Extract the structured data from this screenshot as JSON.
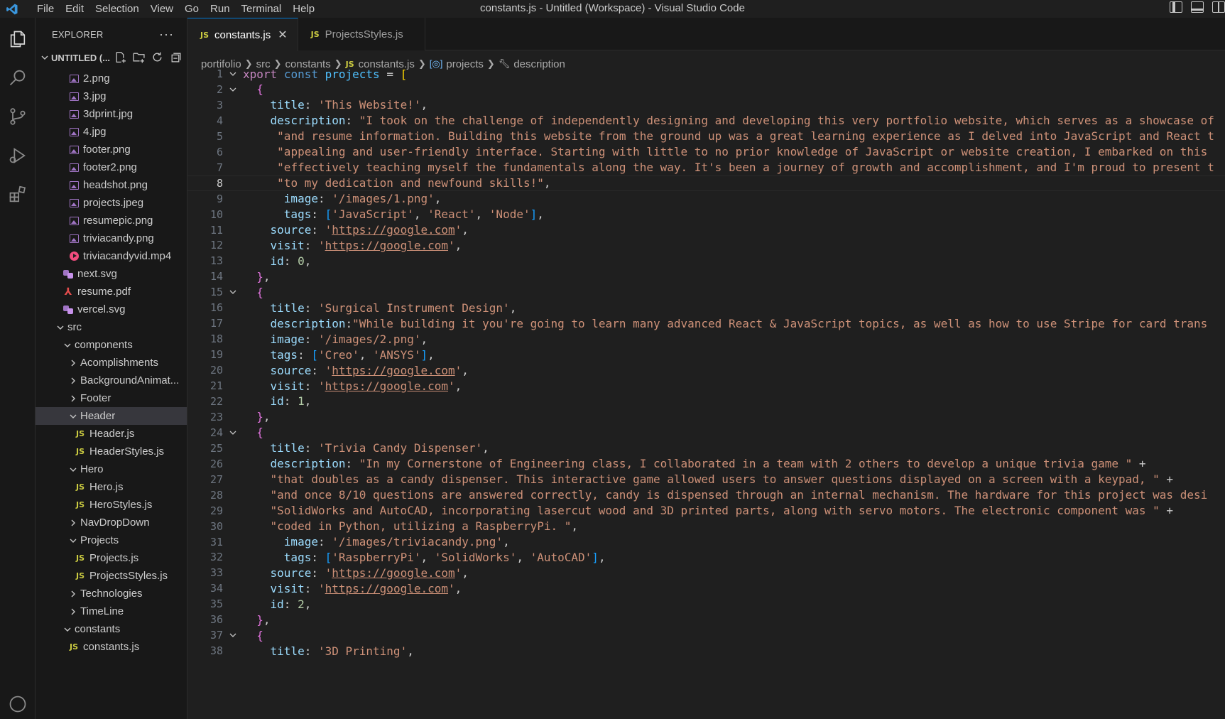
{
  "window": {
    "title": "constants.js - Untitled (Workspace) - Visual Studio Code",
    "menu": [
      "File",
      "Edit",
      "Selection",
      "View",
      "Go",
      "Run",
      "Terminal",
      "Help"
    ]
  },
  "sidebar": {
    "title": "EXPLORER",
    "workspace": "UNTITLED (...",
    "tree": [
      {
        "label": "2.png",
        "icon": "image-icon",
        "depth": 3
      },
      {
        "label": "3.jpg",
        "icon": "image-icon",
        "depth": 3
      },
      {
        "label": "3dprint.jpg",
        "icon": "image-icon",
        "depth": 3
      },
      {
        "label": "4.jpg",
        "icon": "image-icon",
        "depth": 3
      },
      {
        "label": "footer.png",
        "icon": "image-icon",
        "depth": 3
      },
      {
        "label": "footer2.png",
        "icon": "image-icon",
        "depth": 3
      },
      {
        "label": "headshot.png",
        "icon": "image-icon",
        "depth": 3
      },
      {
        "label": "projects.jpeg",
        "icon": "image-icon",
        "depth": 3
      },
      {
        "label": "resumepic.png",
        "icon": "image-icon",
        "depth": 3
      },
      {
        "label": "triviacandy.png",
        "icon": "image-icon",
        "depth": 3
      },
      {
        "label": "triviacandyvid.mp4",
        "icon": "video-icon",
        "depth": 3
      },
      {
        "label": "next.svg",
        "icon": "svg-file-icon",
        "depth": 2
      },
      {
        "label": "resume.pdf",
        "icon": "pdf-icon",
        "depth": 2
      },
      {
        "label": "vercel.svg",
        "icon": "svg-file-icon",
        "depth": 2
      },
      {
        "label": "src",
        "icon": "chevron-down-icon",
        "depth": 1
      },
      {
        "label": "components",
        "icon": "chevron-down-icon",
        "depth": 2
      },
      {
        "label": "Acomplishments",
        "icon": "chevron-right-icon",
        "depth": 3
      },
      {
        "label": "BackgroundAnimat...",
        "icon": "chevron-right-icon",
        "depth": 3
      },
      {
        "label": "Footer",
        "icon": "chevron-right-icon",
        "depth": 3
      },
      {
        "label": "Header",
        "icon": "chevron-down-icon",
        "depth": 3,
        "selected": true
      },
      {
        "label": "Header.js",
        "icon": "js-file-icon",
        "depth": 4
      },
      {
        "label": "HeaderStyles.js",
        "icon": "js-file-icon",
        "depth": 4
      },
      {
        "label": "Hero",
        "icon": "chevron-down-icon",
        "depth": 3
      },
      {
        "label": "Hero.js",
        "icon": "js-file-icon",
        "depth": 4
      },
      {
        "label": "HeroStyles.js",
        "icon": "js-file-icon",
        "depth": 4
      },
      {
        "label": "NavDropDown",
        "icon": "chevron-right-icon",
        "depth": 3
      },
      {
        "label": "Projects",
        "icon": "chevron-down-icon",
        "depth": 3
      },
      {
        "label": "Projects.js",
        "icon": "js-file-icon",
        "depth": 4
      },
      {
        "label": "ProjectsStyles.js",
        "icon": "js-file-icon",
        "depth": 4
      },
      {
        "label": "Technologies",
        "icon": "chevron-right-icon",
        "depth": 3
      },
      {
        "label": "TimeLine",
        "icon": "chevron-right-icon",
        "depth": 3
      },
      {
        "label": "constants",
        "icon": "chevron-down-icon",
        "depth": 2
      },
      {
        "label": "constants.js",
        "icon": "js-file-icon",
        "depth": 3
      }
    ]
  },
  "tabs": [
    {
      "label": "constants.js",
      "active": true,
      "close": "✕"
    },
    {
      "label": "ProjectsStyles.js",
      "active": false
    }
  ],
  "breadcrumb": [
    "portifolio",
    "src",
    "constants",
    "constants.js",
    "projects",
    "description"
  ],
  "editor": {
    "current_line": 8,
    "lines": [
      {
        "n": "1",
        "fold": "v",
        "code": "xport const projects = ["
      },
      {
        "n": "2",
        "fold": "v",
        "code": "  {"
      },
      {
        "n": "3",
        "code": "    title: 'This Website!',"
      },
      {
        "n": "4",
        "code": "    description: \"I took on the challenge of independently designing and developing this very portfolio website, which serves as a showcase of"
      },
      {
        "n": "5",
        "code": "     \"and resume information. Building this website from the ground up was a great learning experience as I delved into JavaScript and React t"
      },
      {
        "n": "6",
        "code": "     \"appealing and user-friendly interface. Starting with little to no prior knowledge of JavaScript or website creation, I embarked on this"
      },
      {
        "n": "7",
        "code": "     \"effectively teaching myself the fundamentals along the way. It's been a journey of growth and accomplishment, and I'm proud to present t"
      },
      {
        "n": "8",
        "code": "     \"to my dedication and newfound skills!\","
      },
      {
        "n": "9",
        "code": "      image: '/images/1.png',"
      },
      {
        "n": "10",
        "code": "      tags: ['JavaScript', 'React', 'Node'],"
      },
      {
        "n": "11",
        "code": "    source: 'https://google.com',"
      },
      {
        "n": "12",
        "code": "    visit: 'https://google.com',"
      },
      {
        "n": "13",
        "code": "    id: 0,"
      },
      {
        "n": "14",
        "code": "  },"
      },
      {
        "n": "15",
        "fold": "v",
        "code": "  {"
      },
      {
        "n": "16",
        "code": "    title: 'Surgical Instrument Design',"
      },
      {
        "n": "17",
        "code": "    description:\"While building it you're going to learn many advanced React & JavaScript topics, as well as how to use Stripe for card trans"
      },
      {
        "n": "18",
        "code": "    image: '/images/2.png',"
      },
      {
        "n": "19",
        "code": "    tags: ['Creo', 'ANSYS'],"
      },
      {
        "n": "20",
        "code": "    source: 'https://google.com',"
      },
      {
        "n": "21",
        "code": "    visit: 'https://google.com',"
      },
      {
        "n": "22",
        "code": "    id: 1,"
      },
      {
        "n": "23",
        "code": "  },"
      },
      {
        "n": "24",
        "fold": "v",
        "code": "  {"
      },
      {
        "n": "25",
        "code": "    title: 'Trivia Candy Dispenser',"
      },
      {
        "n": "26",
        "code": "    description: \"In my Cornerstone of Engineering class, I collaborated in a team with 2 others to develop a unique trivia game \" +"
      },
      {
        "n": "27",
        "code": "    \"that doubles as a candy dispenser. This interactive game allowed users to answer questions displayed on a screen with a keypad, \" +"
      },
      {
        "n": "28",
        "code": "    \"and once 8/10 questions are answered correctly, candy is dispensed through an internal mechanism. The hardware for this project was desi"
      },
      {
        "n": "29",
        "code": "    \"SolidWorks and AutoCAD, incorporating lasercut wood and 3D printed parts, along with servo motors. The electronic component was \" +"
      },
      {
        "n": "30",
        "code": "    \"coded in Python, utilizing a RaspberryPi. \","
      },
      {
        "n": "31",
        "code": "      image: '/images/triviacandy.png',"
      },
      {
        "n": "32",
        "code": "      tags: ['RaspberryPi', 'SolidWorks', 'AutoCAD'],"
      },
      {
        "n": "33",
        "code": "    source: 'https://google.com',"
      },
      {
        "n": "34",
        "code": "    visit: 'https://google.com',"
      },
      {
        "n": "35",
        "code": "    id: 2,"
      },
      {
        "n": "36",
        "code": "  },"
      },
      {
        "n": "37",
        "fold": "v",
        "code": "  {"
      },
      {
        "n": "38",
        "code": "    title: '3D Printing',"
      }
    ]
  }
}
